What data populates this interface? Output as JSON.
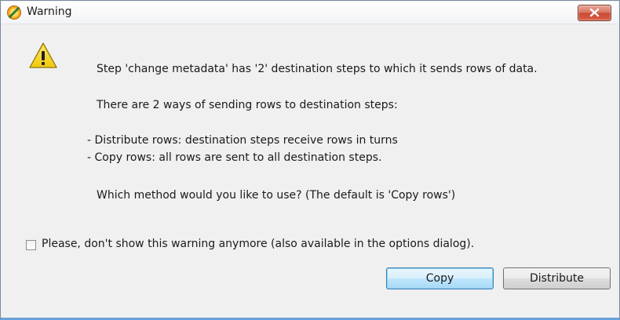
{
  "window": {
    "title": "Warning"
  },
  "message": {
    "line1": "Step 'change metadata' has '2' destination steps to which it sends rows of data.",
    "line2": "There are 2 ways of sending rows to destination steps:",
    "line3": "- Distribute rows: destination steps receive rows in turns",
    "line4": "- Copy rows: all rows are sent to all destination steps.",
    "line5": "Which method would you like to use? (The default is 'Copy rows')"
  },
  "checkbox": {
    "label": "Please, don't show this warning anymore (also available in the options dialog).",
    "checked": false
  },
  "buttons": {
    "copy_label": "Copy",
    "distribute_label": "Distribute"
  },
  "icons": {
    "title": "app-logo-icon",
    "message": "warning-icon",
    "close": "close-icon"
  },
  "colors": {
    "close_button": "#d8735f",
    "default_button_border": "#3c7fb1",
    "warning_yellow": "#f5d322"
  }
}
